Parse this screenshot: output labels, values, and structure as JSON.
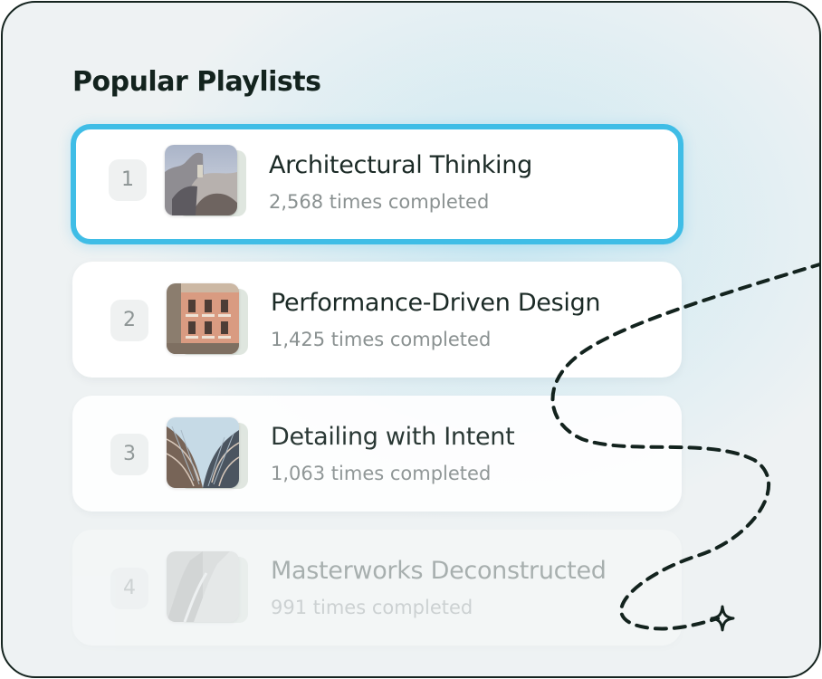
{
  "title": "Popular Playlists",
  "playlists": [
    {
      "rank": "1",
      "name": "Architectural Thinking",
      "count": "2,568 times completed",
      "active": true
    },
    {
      "rank": "2",
      "name": "Performance-Driven Design",
      "count": "1,425 times completed"
    },
    {
      "rank": "3",
      "name": "Detailing with Intent",
      "count": "1,063 times completed"
    },
    {
      "rank": "4",
      "name": "Masterworks Deconstructed",
      "count": "991 times completed"
    }
  ],
  "colors": {
    "accent": "#3fbde6",
    "title_text": "#13231e",
    "frame_border": "#15241f",
    "muted_text": "#8a9191"
  },
  "icons": [
    "dashed-path-decoration",
    "sparkle-icon"
  ]
}
